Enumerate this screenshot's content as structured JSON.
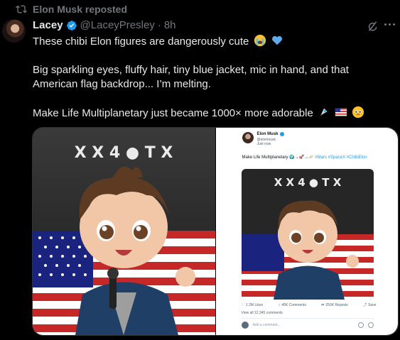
{
  "repost": {
    "label": "Elon Musk reposted"
  },
  "post": {
    "author_name": "Lacey",
    "handle": "@LaceyPresley",
    "separator": "·",
    "time": "8h",
    "line1": "These chibi Elon figures are dangerously cute",
    "line2": "Big sparkling eyes, fluffy hair, tiny blue jacket, mic in hand, and that American flag backdrop... I’m melting.",
    "line3": "Make Life Multiplanetary just became 1000× more adorable"
  },
  "icons": {
    "repost": "repost-icon",
    "verified": "verified-badge-icon",
    "grok": "grok-icon",
    "more": "more-icon"
  },
  "media": {
    "logo_row": "X X 4 ● T X",
    "embedded": {
      "name": "Elon Musk",
      "handle": "@elonmusk",
      "time": "Just now",
      "text": "Make Life Multiplanetary",
      "hashtags": "#Mars #SpaceX #ChibiElon",
      "likes": "1.2M Likes",
      "comments": "45K Comments",
      "reposts": "250K Reposts",
      "save": "Save",
      "view_all": "View all 12,345 comments",
      "add_comment": "Add a comment..."
    }
  },
  "colors": {
    "background": "#000000",
    "text": "#e7e9ea",
    "secondary": "#71767b",
    "accent": "#1d9bf0"
  }
}
